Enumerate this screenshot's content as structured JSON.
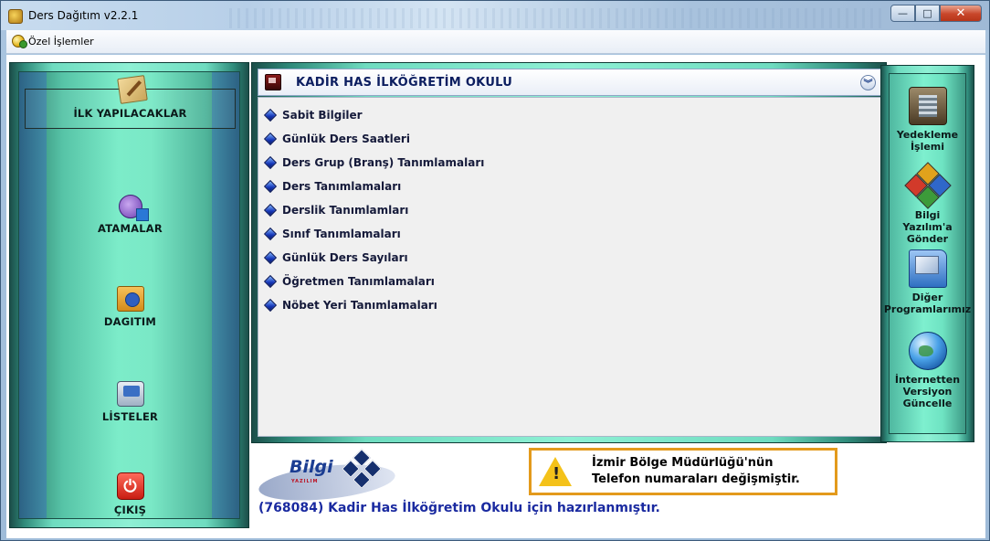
{
  "window": {
    "title": "Ders Dağıtım v2.2.1",
    "minimize": "—",
    "maximize": "□",
    "close": "✕"
  },
  "menu": {
    "items": [
      "Özel İşlemler"
    ]
  },
  "left_nav": [
    {
      "label": "İLK YAPILACAKLAR",
      "icon": "pencil-paper-icon",
      "active": true
    },
    {
      "label": "ATAMALAR",
      "icon": "assign-icon"
    },
    {
      "label": "DAGITIM",
      "icon": "distribution-icon"
    },
    {
      "label": "LİSTELER",
      "icon": "printer-list-icon"
    },
    {
      "label": "ÇIKIŞ",
      "icon": "power-exit-icon"
    }
  ],
  "center": {
    "title": "KADİR HAS İLKÖĞRETİM OKULU",
    "tasks": [
      "Sabit Bilgiler",
      "Günlük Ders Saatleri",
      "Ders Grup (Branş) Tanımlamaları",
      "Ders Tanımlamaları",
      "Derslik Tanımlamları",
      "Sınıf Tanımlamaları",
      "Günlük Ders Sayıları",
      "Öğretmen Tanımlamaları",
      "Nöbet Yeri Tanımlamaları"
    ]
  },
  "right_tools": [
    {
      "label": "Yedekleme İşlemi",
      "icon": "backup-icon"
    },
    {
      "label": "Bilgi Yazılım'a Gönder",
      "icon": "send-diamonds-icon"
    },
    {
      "label": "Diğer Programlarımız",
      "icon": "folder-icon"
    },
    {
      "label": "İnternetten Versiyon Güncelle",
      "icon": "globe-icon"
    }
  ],
  "banner": {
    "logo_text": "Bilgi",
    "logo_sub": "YAZILIM",
    "notice_line1": "İzmir Bölge Müdürlüğü'nün",
    "notice_line2": "Telefon numaraları değişmiştir.",
    "prepared_for": "(768084) Kadir Has İlköğretim Okulu için hazırlanmıştır."
  },
  "colors": {
    "accent_green": "#7cecc9",
    "title_blue": "#0c1e60",
    "notice_border": "#e39a1c",
    "prepared_text": "#1a2aa0"
  }
}
